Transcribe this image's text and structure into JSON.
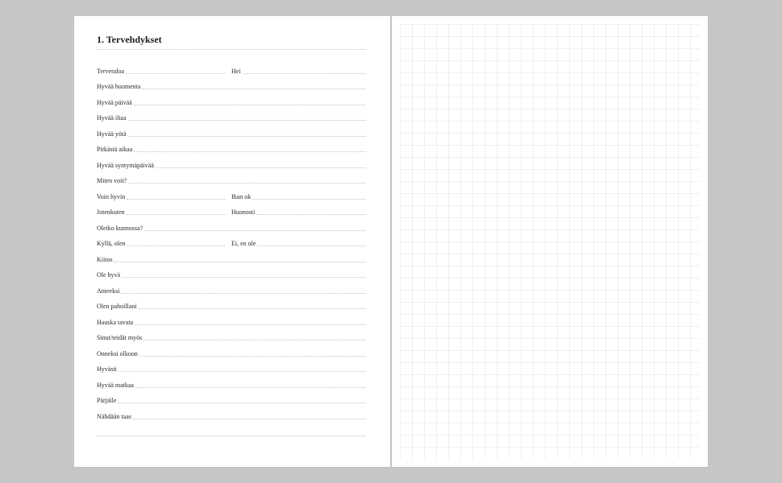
{
  "title": "1. Tervehdykset",
  "rows": [
    {
      "type": "split",
      "left": "Tervetuloa",
      "right": "Hei"
    },
    {
      "type": "full",
      "text": "Hyvää huomenta"
    },
    {
      "type": "full",
      "text": "Hyvää päivää"
    },
    {
      "type": "full",
      "text": "Hyvää iltaa"
    },
    {
      "type": "full",
      "text": "Hyvää yötä"
    },
    {
      "type": "full",
      "text": "Pitkästä aikaa"
    },
    {
      "type": "full",
      "text": "Hyvää syntymäpäivää"
    },
    {
      "type": "full",
      "text": "Miten voit?"
    },
    {
      "type": "split",
      "left": "Voin hyvin",
      "right": "Ihan ok"
    },
    {
      "type": "split",
      "left": "Jotenkuten",
      "right": "Huonosti"
    },
    {
      "type": "full",
      "text": "Oletko kunnossa?"
    },
    {
      "type": "split",
      "left": "Kyllä, olen",
      "right": "Ei, en ole"
    },
    {
      "type": "full",
      "text": "Kiitos"
    },
    {
      "type": "full",
      "text": "Ole hyvä"
    },
    {
      "type": "full",
      "text": "Anteeksi"
    },
    {
      "type": "full",
      "text": "Olen pahoillani"
    },
    {
      "type": "full",
      "text": "Hauska tavata"
    },
    {
      "type": "full",
      "text": "Sinut/teidät myös"
    },
    {
      "type": "full",
      "text": "Onneksi olkoon"
    },
    {
      "type": "full",
      "text": "Hyvästi"
    },
    {
      "type": "full",
      "text": "Hyvää matkaa"
    },
    {
      "type": "full",
      "text": "Pärjäile"
    },
    {
      "type": "full",
      "text": "Nähdään taas"
    }
  ]
}
